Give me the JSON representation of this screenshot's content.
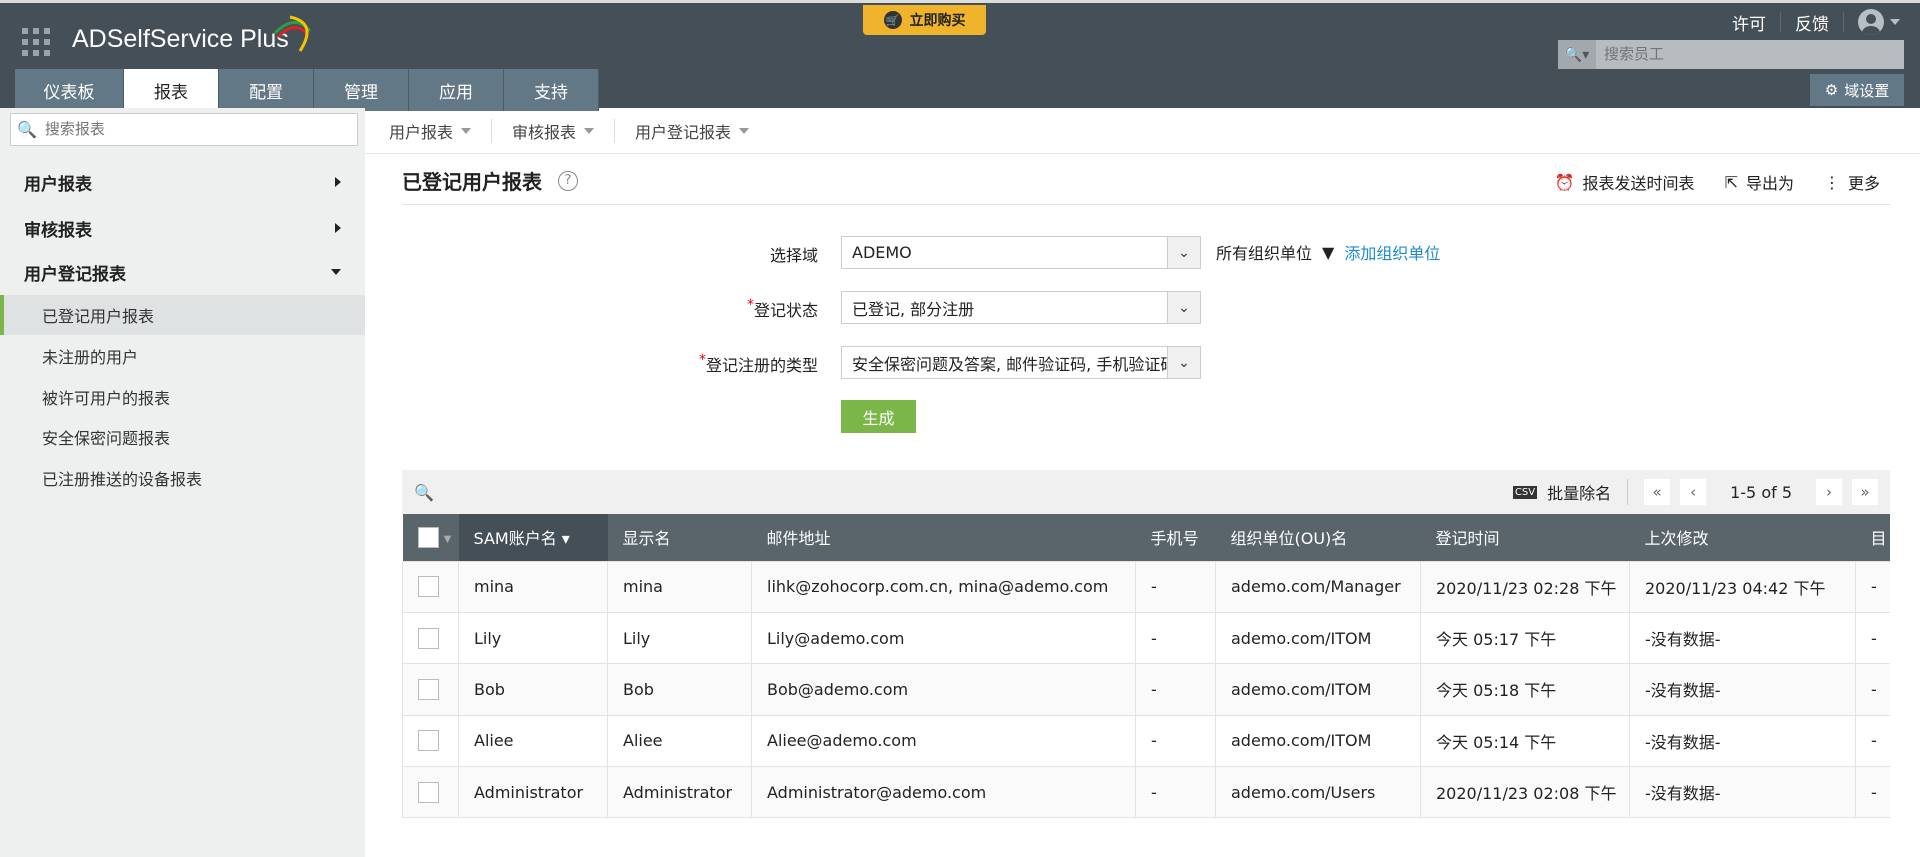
{
  "header": {
    "app_name": "ADSelfService Plus",
    "buy_label": "立即购买",
    "license": "许可",
    "feedback": "反馈",
    "employee_search_placeholder": "搜索员工",
    "domain_settings": "域设置",
    "tabs": [
      "仪表板",
      "报表",
      "配置",
      "管理",
      "应用",
      "支持"
    ],
    "active_tab": "报表"
  },
  "sidebar": {
    "search_placeholder": "搜索报表",
    "groups": [
      "用户报表",
      "审核报表",
      "用户登记报表"
    ],
    "items": [
      "已登记用户报表",
      "未注册的用户",
      "被许可用户的报表",
      "安全保密问题报表",
      "已注册推送的设备报表"
    ],
    "selected": "已登记用户报表"
  },
  "subnav": [
    "用户报表",
    "审核报表",
    "用户登记报表"
  ],
  "page": {
    "title": "已登记用户报表",
    "help": "?",
    "actions": [
      "报表发送时间表",
      "导出为",
      "更多"
    ]
  },
  "form": {
    "domain_label": "选择域",
    "domain_value": "ADEMO",
    "ou_label": "所有组织单位",
    "add_ou": "添加组织单位",
    "status_label": "登记状态",
    "status_value": "已登记, 部分注册",
    "type_label": "登记注册的类型",
    "type_value": "安全保密问题及答案, 邮件验证码, 手机验证码",
    "required": "*",
    "generate": "生成"
  },
  "toolbar": {
    "bulk_unenroll": "批量除名",
    "page_info": "1-5 of 5",
    "csv": "CSV"
  },
  "table": {
    "columns": [
      "SAM账户名",
      "显示名",
      "邮件地址",
      "手机号",
      "组织单位(OU)名",
      "登记时间",
      "上次修改",
      "目"
    ],
    "rows": [
      [
        "mina",
        "mina",
        "lihk@zohocorp.com.cn, mina@ademo.com",
        "-",
        "ademo.com/Manager",
        "2020/11/23 02:28 下午",
        "2020/11/23 04:42 下午",
        "-"
      ],
      [
        "Lily",
        "Lily",
        "Lily@ademo.com",
        "-",
        "ademo.com/ITOM",
        "今天 05:17 下午",
        "-没有数据-",
        "-"
      ],
      [
        "Bob",
        "Bob",
        "Bob@ademo.com",
        "-",
        "ademo.com/ITOM",
        "今天 05:18 下午",
        "-没有数据-",
        "-"
      ],
      [
        "Aliee",
        "Aliee",
        "Aliee@ademo.com",
        "-",
        "ademo.com/ITOM",
        "今天 05:14 下午",
        "-没有数据-",
        "-"
      ],
      [
        "Administrator",
        "Administrator",
        "Administrator@ademo.com",
        "-",
        "ademo.com/Users",
        "2020/11/23 02:08 下午",
        "-没有数据-",
        "-"
      ]
    ]
  },
  "colors": {
    "topbar": "#444f58",
    "tab": "#627886",
    "accent_green": "#7ab648",
    "buy": "#f0b42c",
    "link": "#1d8acb"
  }
}
